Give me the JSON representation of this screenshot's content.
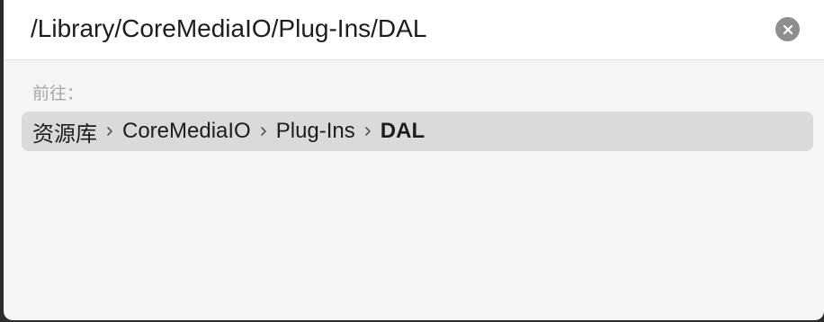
{
  "goto": {
    "path_value": "/Library/CoreMediaIO/Plug-Ins/DAL",
    "label": "前往：",
    "suggestion": {
      "crumbs": [
        "资源库",
        "CoreMediaIO",
        "Plug-Ins",
        "DAL"
      ]
    }
  },
  "icons": {
    "clear": "close-circle-icon",
    "separator": "chevron-right-icon"
  }
}
